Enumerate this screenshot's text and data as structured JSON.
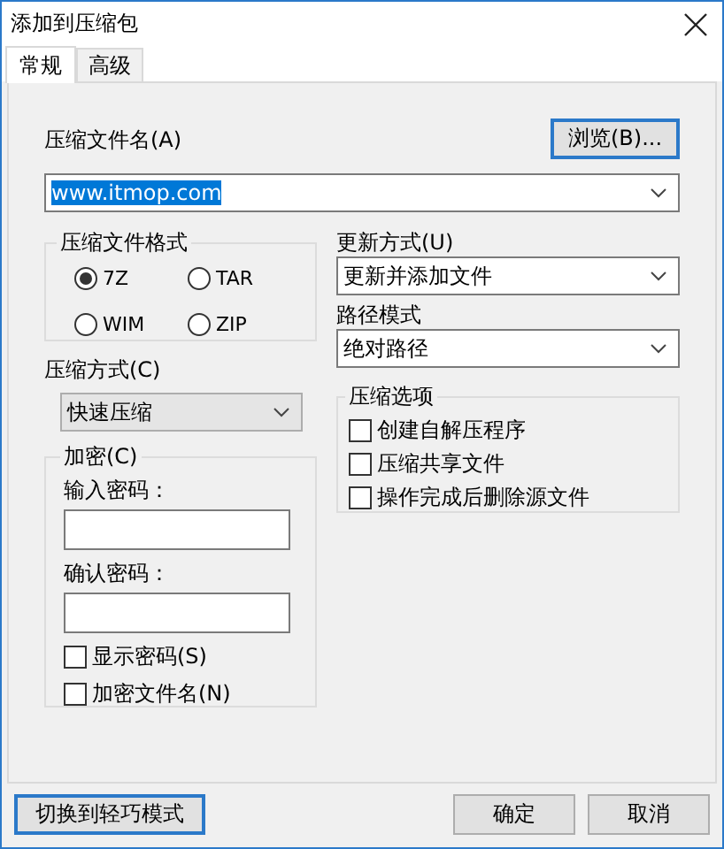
{
  "window": {
    "title": "添加到压缩包"
  },
  "tabs": [
    {
      "label": "常规",
      "selected": true
    },
    {
      "label": "高级",
      "selected": false
    }
  ],
  "archive_name": {
    "label": "压缩文件名(A)",
    "browse_button": "浏览(B)...",
    "value": "www.itmop.com",
    "value_selected": true
  },
  "format_group": {
    "title": "压缩文件格式",
    "options": [
      {
        "label": "7Z",
        "selected": true
      },
      {
        "label": "TAR",
        "selected": false
      },
      {
        "label": "WIM",
        "selected": false
      },
      {
        "label": "ZIP",
        "selected": false
      }
    ]
  },
  "update_mode": {
    "label": "更新方式(U)",
    "value": "更新并添加文件"
  },
  "path_mode": {
    "label": "路径模式",
    "value": "绝对路径"
  },
  "compression_method": {
    "label": "压缩方式(C)",
    "value": "快速压缩"
  },
  "options_group": {
    "title": "压缩选项",
    "items": [
      {
        "label": "创建自解压程序",
        "checked": false
      },
      {
        "label": "压缩共享文件",
        "checked": false
      },
      {
        "label": "操作完成后删除源文件",
        "checked": false
      }
    ]
  },
  "encryption": {
    "title": "加密(C)",
    "password_label": "输入密码：",
    "confirm_label": "确认密码：",
    "checkboxes": [
      {
        "label": "显示密码(S)",
        "checked": false
      },
      {
        "label": "加密文件名(N)",
        "checked": false
      }
    ]
  },
  "buttons": [
    {
      "label": "切换到轻巧模式",
      "focused": true
    },
    {
      "label": "确定",
      "focused": false
    },
    {
      "label": "取消",
      "focused": false
    }
  ]
}
